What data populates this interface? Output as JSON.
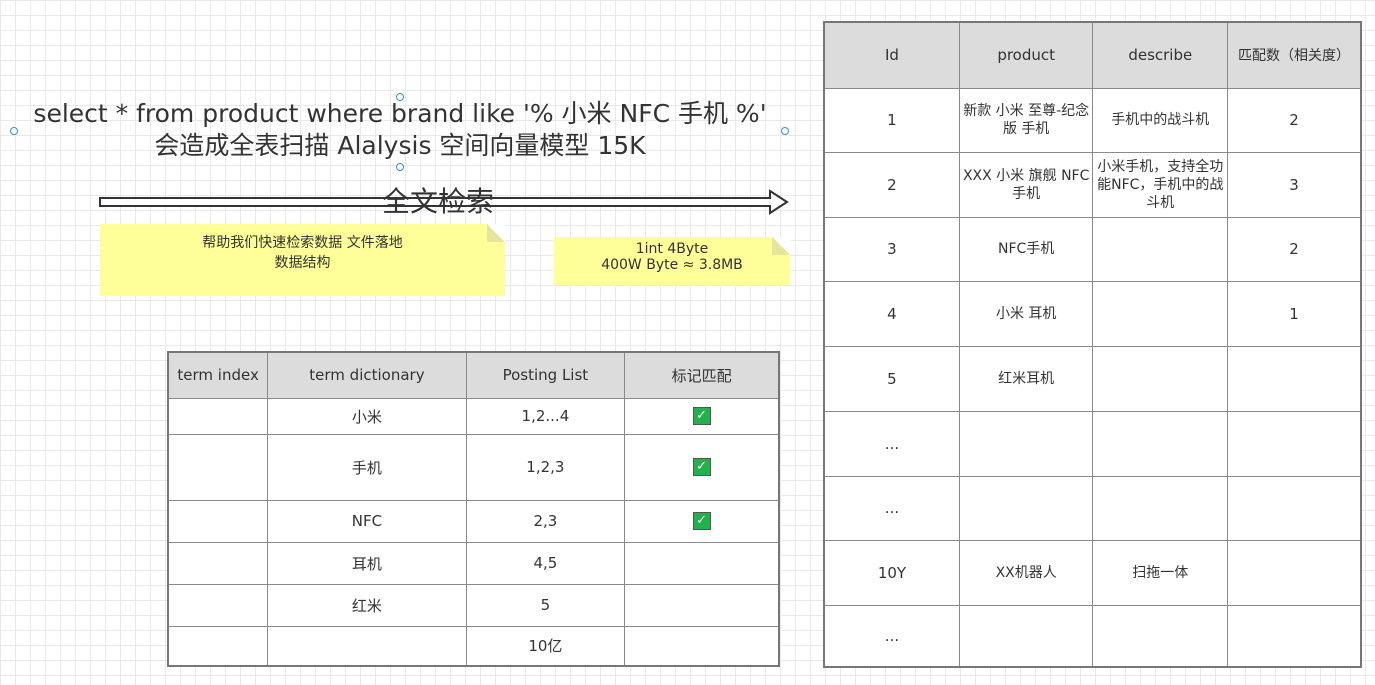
{
  "sql": {
    "line1": "select * from product where brand like '% 小米 NFC 手机 %'",
    "line2": "会造成全表扫描 Alalysis  空间向量模型 15K"
  },
  "arrow": {
    "label": "全文检索"
  },
  "notes": {
    "left": {
      "line1": "帮助我们快速检索数据 文件落地",
      "line2": "数据结构"
    },
    "right": {
      "line1": "1int 4Byte",
      "line2": "400W Byte ≈ 3.8MB"
    }
  },
  "term_table": {
    "headers": [
      "term index",
      "term dictionary",
      "Posting List",
      "标记匹配"
    ],
    "rows": [
      {
        "index": "",
        "term": "小米",
        "postings": "1,2...4",
        "matched": true
      },
      {
        "index": "",
        "term": "手机",
        "postings": "1,2,3",
        "matched": true
      },
      {
        "index": "",
        "term": "NFC",
        "postings": "2,3",
        "matched": true
      },
      {
        "index": "",
        "term": "耳机",
        "postings": "4,5",
        "matched": false
      },
      {
        "index": "",
        "term": "红米",
        "postings": "5",
        "matched": false
      },
      {
        "index": "",
        "term": "",
        "postings": "10亿",
        "matched": false
      }
    ]
  },
  "doc_table": {
    "headers": [
      "Id",
      "product",
      "describe",
      "匹配数（相关度）"
    ],
    "rows": [
      {
        "id": "1",
        "product": "新款 小米 至尊-纪念版 手机",
        "describe": "手机中的战斗机",
        "score": "2"
      },
      {
        "id": "2",
        "product": "XXX 小米 旗舰 NFC 手机",
        "describe": "小米手机，支持全功能NFC，手机中的战斗机",
        "score": "3"
      },
      {
        "id": "3",
        "product": "NFC手机",
        "describe": "",
        "score": "2"
      },
      {
        "id": "4",
        "product": "小米 耳机",
        "describe": "",
        "score": "1"
      },
      {
        "id": "5",
        "product": "红米耳机",
        "describe": "",
        "score": ""
      },
      {
        "id": "...",
        "product": "",
        "describe": "",
        "score": ""
      },
      {
        "id": "...",
        "product": "",
        "describe": "",
        "score": ""
      },
      {
        "id": "10Y",
        "product": "XX机器人",
        "describe": "扫拖一体",
        "score": ""
      },
      {
        "id": "...",
        "product": "",
        "describe": "",
        "score": ""
      }
    ]
  },
  "icons": {
    "check": "checkbox-checked-icon"
  },
  "colors": {
    "note": "#ffff99",
    "check": "#22b14c",
    "header": "#dcdcdc",
    "handle": "#3b8cd4"
  }
}
